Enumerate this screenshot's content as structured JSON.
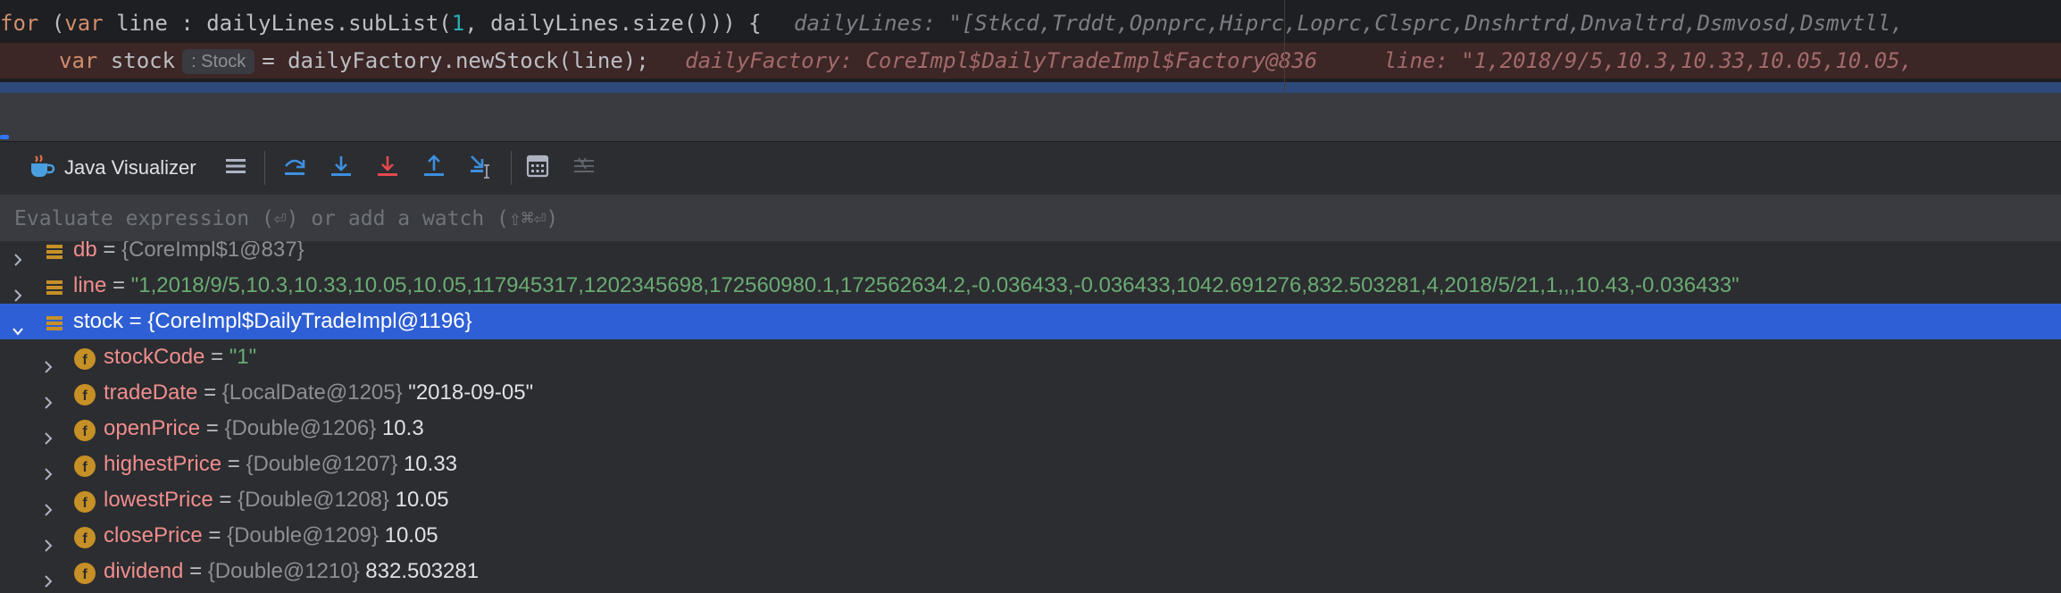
{
  "editor": {
    "line1": {
      "kw_for": "for",
      "open": " (",
      "kw_var": "var",
      "mid": " line : dailyLines.subList(",
      "num": "1",
      "rest": ", dailyLines.size())) {",
      "hint": "dailyLines: \"[Stkcd,Trddt,Opnprc,Hiprc,Loprc,Clsprc,Dnshrtrd,Dnvaltrd,Dsmvosd,Dsmvtll,"
    },
    "line2": {
      "kw_var": "var",
      "ident": "stock",
      "type_hint": ": Stock",
      "code": "= dailyFactory.newStock(line);",
      "hint1": "dailyFactory: CoreImpl$DailyTradeImpl$Factory@836",
      "hint2": "line: \"1,2018/9/5,10.3,10.33,10.05,10.05,"
    }
  },
  "toolbar": {
    "visualizer_label": "Java Visualizer",
    "icons": [
      "java-visualizer-icon",
      "frames-icon",
      "step-over-icon",
      "step-into-icon",
      "force-step-into-icon",
      "step-out-icon",
      "run-to-cursor-icon",
      "evaluate-expression-icon",
      "trace-current-stream-icon"
    ]
  },
  "watch": {
    "placeholder": "Evaluate expression (⏎) or add a watch (⇧⌘⏎)"
  },
  "variables": [
    {
      "name": "db",
      "eq": " = ",
      "ref": "{CoreImpl$1@837}",
      "value": "",
      "kind": "var",
      "expanded": false,
      "selected": false,
      "depth": 0
    },
    {
      "name": "line",
      "eq": " = ",
      "ref": "",
      "value": "\"1,2018/9/5,10.3,10.33,10.05,10.05,117945317,1202345698,172560980.1,172562634.2,-0.036433,-0.036433,1042.691276,832.503281,4,2018/5/21,1,,,10.43,-0.036433\"",
      "kind": "var",
      "expanded": false,
      "selected": false,
      "depth": 0
    },
    {
      "name": "stock",
      "eq": " = ",
      "ref": "{CoreImpl$DailyTradeImpl@1196}",
      "value": "",
      "kind": "var",
      "expanded": true,
      "selected": true,
      "depth": 0
    },
    {
      "name": "stockCode",
      "eq": " = ",
      "ref": "",
      "value": "\"1\"",
      "kind": "field",
      "expanded": false,
      "selected": false,
      "depth": 1
    },
    {
      "name": "tradeDate",
      "eq": " = ",
      "ref": "{LocalDate@1205}",
      "value": " \"2018-09-05\"",
      "kind": "field",
      "expanded": false,
      "selected": false,
      "depth": 1
    },
    {
      "name": "openPrice",
      "eq": " = ",
      "ref": "{Double@1206}",
      "value": " 10.3",
      "kind": "field",
      "expanded": false,
      "selected": false,
      "depth": 1
    },
    {
      "name": "highestPrice",
      "eq": " = ",
      "ref": "{Double@1207}",
      "value": " 10.33",
      "kind": "field",
      "expanded": false,
      "selected": false,
      "depth": 1
    },
    {
      "name": "lowestPrice",
      "eq": " = ",
      "ref": "{Double@1208}",
      "value": " 10.05",
      "kind": "field",
      "expanded": false,
      "selected": false,
      "depth": 1
    },
    {
      "name": "closePrice",
      "eq": " = ",
      "ref": "{Double@1209}",
      "value": " 10.05",
      "kind": "field",
      "expanded": false,
      "selected": false,
      "depth": 1
    },
    {
      "name": "dividend",
      "eq": " = ",
      "ref": "{Double@1210}",
      "value": " 832.503281",
      "kind": "field",
      "expanded": false,
      "selected": false,
      "depth": 1
    }
  ],
  "colors": {
    "selection": "#2e5fd4",
    "field_icon": "#c69026",
    "var_icon": "#c69026",
    "string_value": "#6aab73",
    "field_name": "#f08d8d"
  }
}
